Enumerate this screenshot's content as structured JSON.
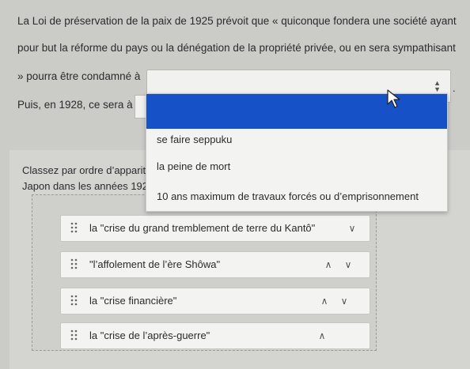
{
  "question": {
    "line1": "La Loi de préservation de la paix de 1925 prévoit que « quiconque fondera une société ayant",
    "line2": "pour but la réforme du pays ou la dénégation de la propriété privée, ou en sera sympathisant",
    "line3": "» pourra être condamné à",
    "trailing": ".",
    "line4": "Puis, en 1928, ce sera à"
  },
  "dropdown": {
    "options": [
      "se faire seppuku",
      "la peine de mort",
      "10 ans maximum de travaux forcés ou d’emprisonnement"
    ],
    "highlight_color": "#1651c7"
  },
  "sort": {
    "instruction_line1": "Classez par ordre d’apparit",
    "instruction_line2": "Japon dans les années 192",
    "items": [
      {
        "label": "la \"crise du grand tremblement de terre du Kantô\""
      },
      {
        "label": "\"l’affolement de l’ère Shôwa\""
      },
      {
        "label": "la \"crise financière\""
      },
      {
        "label": "la \"crise de l’après-guerre\""
      }
    ]
  }
}
